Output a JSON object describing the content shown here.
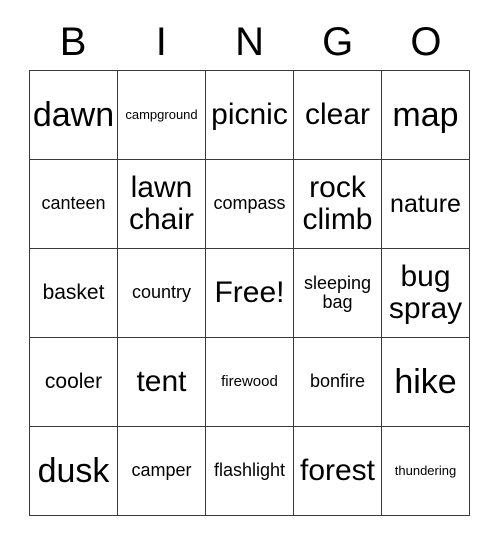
{
  "card": {
    "header_letters": [
      "B",
      "I",
      "N",
      "G",
      "O"
    ],
    "free_space_label": "Free!",
    "colors": {
      "background": "#ffffff",
      "text": "#000000",
      "grid_line": "#3a3a3a"
    },
    "grid": {
      "rows": 5,
      "columns": 5,
      "cells": [
        [
          {
            "text": "dawn",
            "size": "xxxl"
          },
          {
            "text": "campground",
            "size": "xs"
          },
          {
            "text": "picnic",
            "size": "xxl"
          },
          {
            "text": "clear",
            "size": "xxl"
          },
          {
            "text": "map",
            "size": "xxxl"
          }
        ],
        [
          {
            "text": "canteen",
            "size": "m"
          },
          {
            "text": "lawn\nchair",
            "size": "xxl"
          },
          {
            "text": "compass",
            "size": "m"
          },
          {
            "text": "rock\nclimb",
            "size": "xxl"
          },
          {
            "text": "nature",
            "size": "xl"
          }
        ],
        [
          {
            "text": "basket",
            "size": "l"
          },
          {
            "text": "country",
            "size": "m"
          },
          {
            "text": "Free!",
            "size": "xxl"
          },
          {
            "text": "sleeping\nbag",
            "size": "m"
          },
          {
            "text": "bug\nspray",
            "size": "xxl"
          }
        ],
        [
          {
            "text": "cooler",
            "size": "l"
          },
          {
            "text": "tent",
            "size": "xxl"
          },
          {
            "text": "firewood",
            "size": "s"
          },
          {
            "text": "bonfire",
            "size": "m"
          },
          {
            "text": "hike",
            "size": "xxxl"
          }
        ],
        [
          {
            "text": "dusk",
            "size": "xxxl"
          },
          {
            "text": "camper",
            "size": "m"
          },
          {
            "text": "flashlight",
            "size": "m"
          },
          {
            "text": "forest",
            "size": "xxl"
          },
          {
            "text": "thundering",
            "size": "xs"
          }
        ]
      ]
    }
  }
}
